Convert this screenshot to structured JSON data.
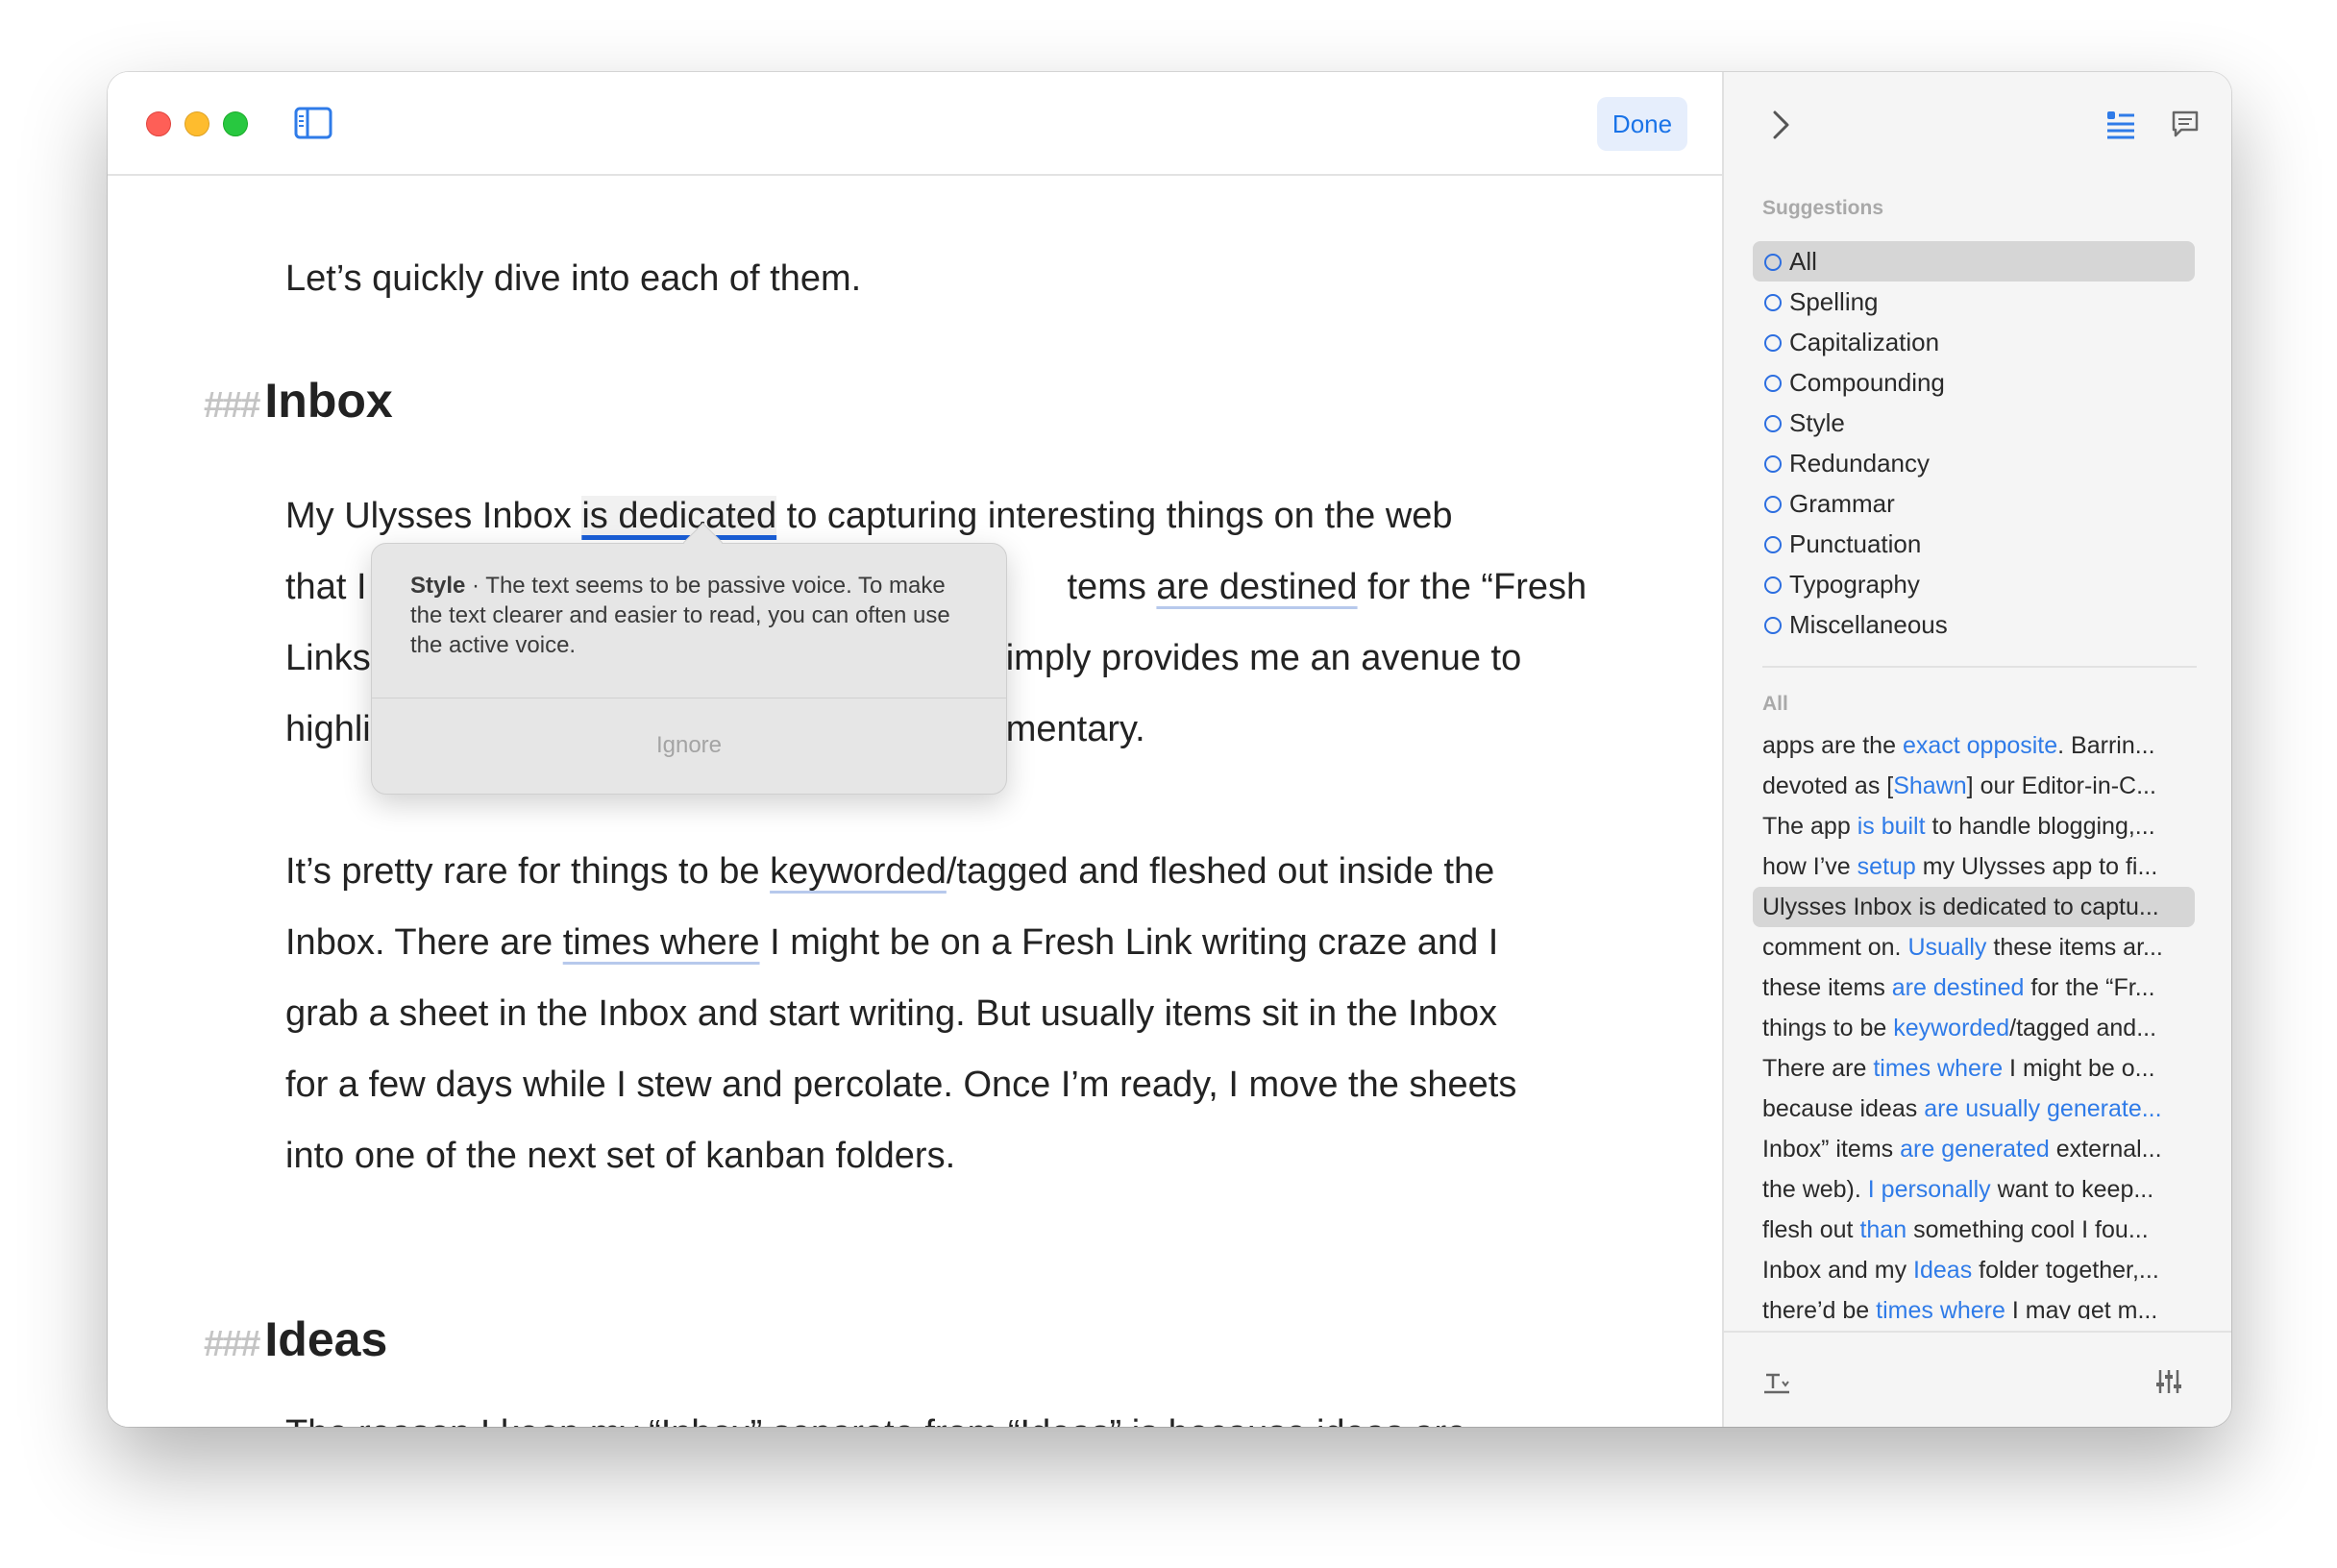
{
  "toolbar": {
    "done_label": "Done"
  },
  "editor": {
    "intro": "Let’s quickly dive into each of them.",
    "heading_mark": "###",
    "heading_inbox": "Inbox",
    "heading_ideas": "Ideas",
    "p1_l1": {
      "a": "My Ulysses Inbox ",
      "flag": "is dedicated",
      "b": " to capturing interesting things on the web"
    },
    "p1_l2": {
      "a": "that I",
      "b": "tems ",
      "flag": "are destined",
      "c": " for the “Fresh"
    },
    "p1_l3": {
      "a": "Links",
      "b": "imply provides me an avenue to"
    },
    "p1_l4": {
      "a": "highli",
      "b": "mentary."
    },
    "p2_l1": {
      "a": "It’s pretty rare for things to be ",
      "flag": "keyworded",
      "b": "/tagged and fleshed out inside the"
    },
    "p2_l2": {
      "a": "Inbox. There are ",
      "flag": "times where",
      "b": " I might be on a Fresh Link writing craze and I"
    },
    "p2_l3": "grab a sheet in the Inbox and start writing. But usually items sit in the Inbox",
    "p2_l4": "for a few days while I stew and percolate. Once I’m ready, I move the sheets",
    "p2_l5": "into one of the next set of kanban folders.",
    "p3_l1": "The reason I keep my “Inbox” separate from “Ideas” is because ideas are"
  },
  "popover": {
    "category": "Style",
    "separator": " · ",
    "message": "The text seems to be passive voice. To make the text clearer and easier to read, you can often use the active voice.",
    "ignore_label": "Ignore"
  },
  "sidebar": {
    "suggestions_title": "Suggestions",
    "categories": [
      {
        "label": "All"
      },
      {
        "label": "Spelling"
      },
      {
        "label": "Capitalization"
      },
      {
        "label": "Compounding"
      },
      {
        "label": "Style"
      },
      {
        "label": "Redundancy"
      },
      {
        "label": "Grammar"
      },
      {
        "label": "Punctuation"
      },
      {
        "label": "Typography"
      },
      {
        "label": "Miscellaneous"
      }
    ],
    "all_title": "All",
    "items": [
      {
        "pre": "apps are the ",
        "hl": "exact opposite",
        "post": ". Barrin..."
      },
      {
        "pre": "devoted as [",
        "hl": "Shawn",
        "post": "] our Editor-in-C..."
      },
      {
        "pre": "The app ",
        "hl": "is built",
        "post": " to handle blogging,..."
      },
      {
        "pre": "how I’ve ",
        "hl": "setup",
        "post": " my Ulysses app to fi..."
      },
      {
        "pre": "Ulysses Inbox ",
        "hl": "is dedicated",
        "post": " to captu..."
      },
      {
        "pre": "comment on. ",
        "hl": "Usually",
        "post": " these items ar..."
      },
      {
        "pre": "these items ",
        "hl": "are destined",
        "post": " for the “Fr..."
      },
      {
        "pre": "things to be ",
        "hl": "keyworded",
        "post": "/tagged and..."
      },
      {
        "pre": "There are ",
        "hl": "times where",
        "post": " I might be o..."
      },
      {
        "pre": "because ideas ",
        "hl": "are usually generate...",
        "post": ""
      },
      {
        "pre": "Inbox” items ",
        "hl": "are generated",
        "post": " external..."
      },
      {
        "pre": "the web). ",
        "hl": "I personally",
        "post": " want to keep..."
      },
      {
        "pre": "flesh out ",
        "hl": "than",
        "post": " something cool I fou..."
      },
      {
        "pre": "Inbox and my ",
        "hl": "Ideas",
        "post": " folder together,..."
      },
      {
        "pre": "there’d be ",
        "hl": "times where",
        "post": " I may get m..."
      }
    ]
  },
  "colors": {
    "accent": "#2f7be8",
    "done_bg": "#e6eefc",
    "passive_underline": "#b7c9ec",
    "active_underline": "#1a5fd8"
  },
  "icons": [
    "sidebar-toggle-icon",
    "chevron-right-icon",
    "suggestions-list-icon",
    "comment-icon",
    "sort-icon",
    "sliders-icon"
  ]
}
